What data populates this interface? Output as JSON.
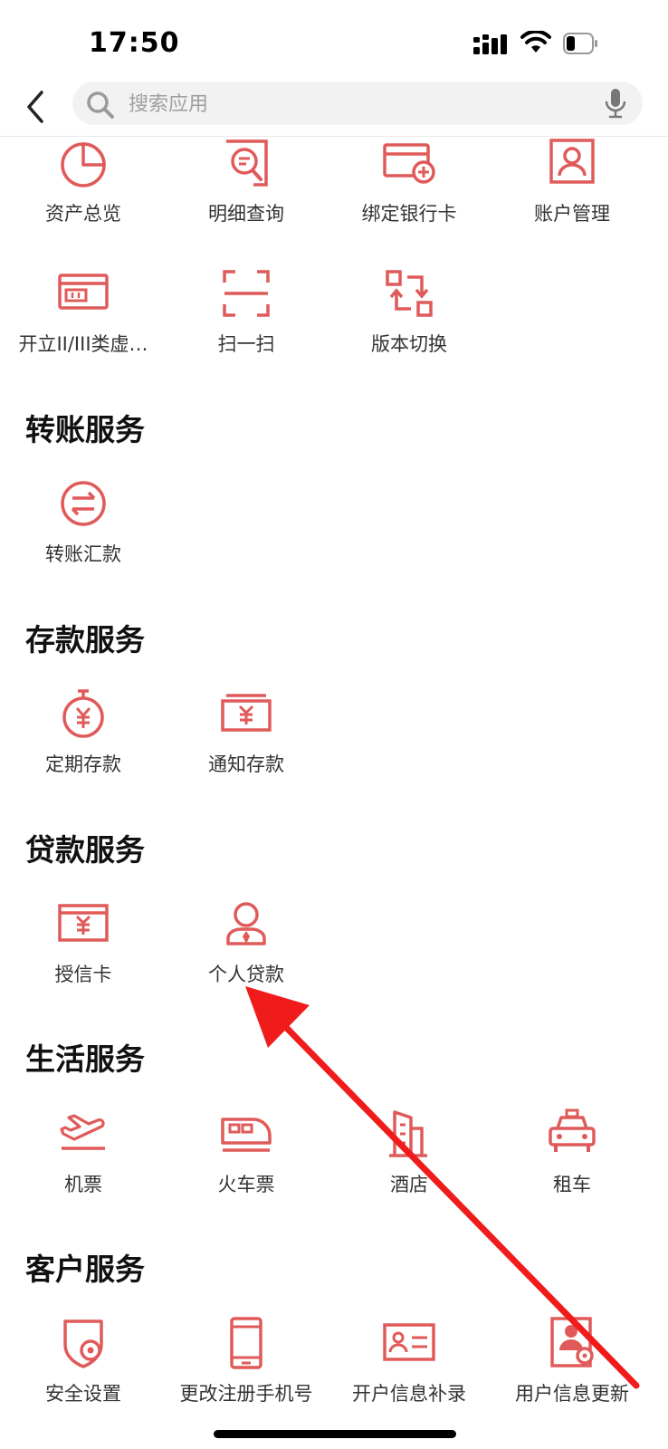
{
  "status_bar": {
    "time": "17:50"
  },
  "search": {
    "placeholder": "搜索应用"
  },
  "colors": {
    "accent": "#e05a5a",
    "annotation_arrow": "#f01c1c"
  },
  "account_items": [
    {
      "label": "资产总览",
      "icon": "pie-chart-icon"
    },
    {
      "label": "明细查询",
      "icon": "search-document-icon"
    },
    {
      "label": "绑定银行卡",
      "icon": "add-card-icon"
    },
    {
      "label": "账户管理",
      "icon": "user-frame-icon"
    },
    {
      "label": "开立II/III类虚…",
      "icon": "virtual-card-icon"
    },
    {
      "label": "扫一扫",
      "icon": "scan-icon"
    },
    {
      "label": "版本切换",
      "icon": "switch-icon"
    }
  ],
  "sections": [
    {
      "title": "转账服务",
      "items": [
        {
          "label": "转账汇款",
          "icon": "transfer-icon"
        }
      ]
    },
    {
      "title": "存款服务",
      "items": [
        {
          "label": "定期存款",
          "icon": "timer-yuan-icon"
        },
        {
          "label": "通知存款",
          "icon": "yuan-box-icon"
        }
      ]
    },
    {
      "title": "贷款服务",
      "items": [
        {
          "label": "授信卡",
          "icon": "credit-card-yuan-icon"
        },
        {
          "label": "个人贷款",
          "icon": "person-loan-icon"
        }
      ]
    },
    {
      "title": "生活服务",
      "items": [
        {
          "label": "机票",
          "icon": "airplane-icon"
        },
        {
          "label": "火车票",
          "icon": "train-icon"
        },
        {
          "label": "酒店",
          "icon": "hotel-icon"
        },
        {
          "label": "租车",
          "icon": "taxi-icon"
        }
      ]
    },
    {
      "title": "客户服务",
      "items": [
        {
          "label": "安全设置",
          "icon": "shield-gear-icon"
        },
        {
          "label": "更改注册手机号",
          "icon": "phone-icon"
        },
        {
          "label": "开户信息补录",
          "icon": "id-card-icon"
        },
        {
          "label": "用户信息更新",
          "icon": "user-gear-icon"
        }
      ]
    }
  ]
}
